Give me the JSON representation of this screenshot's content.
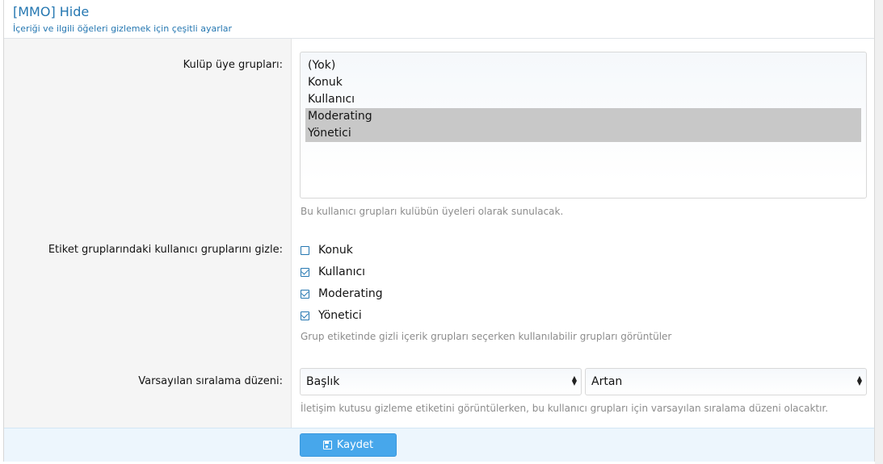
{
  "header": {
    "title": "[MMO] Hide",
    "subtitle": "İçeriği ve ilgili öğeleri gizlemek için çeşitli ayarlar"
  },
  "club_groups": {
    "label": "Kulüp üye grupları:",
    "options": [
      {
        "label": "(Yok)",
        "selected": false
      },
      {
        "label": "Konuk",
        "selected": false
      },
      {
        "label": "Kullanıcı",
        "selected": false
      },
      {
        "label": "Moderating",
        "selected": true
      },
      {
        "label": "Yönetici",
        "selected": true
      }
    ],
    "hint": "Bu kullanıcı grupları kulübün üyeleri olarak sunulacak."
  },
  "hide_groups": {
    "label": "Etiket gruplarındaki kullanıcı gruplarını gizle:",
    "items": [
      {
        "label": "Konuk",
        "checked": false
      },
      {
        "label": "Kullanıcı",
        "checked": true
      },
      {
        "label": "Moderating",
        "checked": true
      },
      {
        "label": "Yönetici",
        "checked": true
      }
    ],
    "hint": "Grup etiketinde gizli içerik grupları seçerken kullanılabilir grupları görüntüler"
  },
  "sort_order": {
    "label": "Varsayılan sıralama düzeni:",
    "field_value": "Başlık",
    "direction_value": "Artan",
    "hint": "İletişim kutusu gizleme etiketini görüntülerken, bu kullanıcı grupları için varsayılan sıralama düzeni olacaktır."
  },
  "footer": {
    "save_label": "Kaydet"
  },
  "colors": {
    "accent": "#2577b1",
    "button": "#47a7eb",
    "footer_bg": "#edf6fd"
  }
}
